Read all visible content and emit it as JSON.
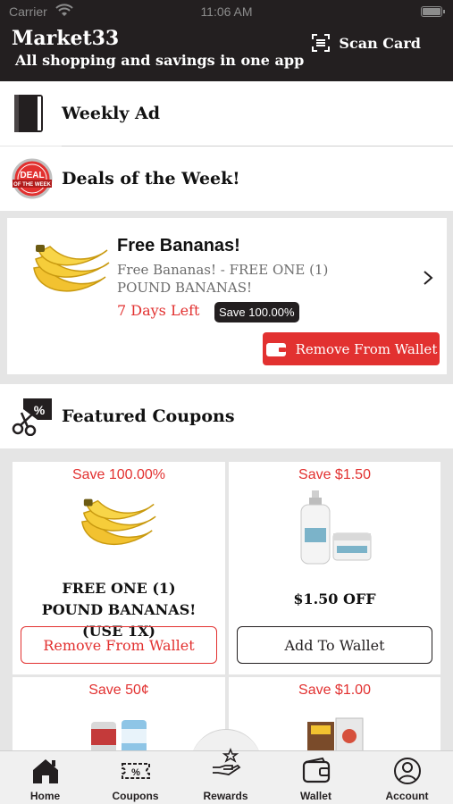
{
  "status_bar": {
    "carrier": "Carrier",
    "time": "11:06 AM"
  },
  "header": {
    "title": "Market33",
    "subtitle": "All shopping and savings in one app",
    "scan_label": "Scan Card"
  },
  "sections": {
    "weekly_ad": "Weekly Ad",
    "deals": "Deals of the Week!",
    "deal_badge_text": [
      "DEAL",
      "OF THE WEEK"
    ],
    "featured": "Featured Coupons"
  },
  "deal": {
    "title": "Free Bananas!",
    "description": "Free Bananas! - FREE ONE (1) POUND BANANAS!",
    "days_left": "7 Days Left",
    "badge": "Save 100.00%",
    "button": "Remove From Wallet"
  },
  "coupons": [
    {
      "save": "Save 100.00%",
      "name": "FREE ONE (1) POUND BANANAS! (USE 1X)",
      "button": "Remove From Wallet"
    },
    {
      "save": "Save $1.50",
      "name": "$1.50 OFF",
      "button": "Add To Wallet"
    },
    {
      "save": "Save 50¢"
    },
    {
      "save": "Save $1.00"
    }
  ],
  "tabs": [
    {
      "label": "Home",
      "icon": "home-icon"
    },
    {
      "label": "Coupons",
      "icon": "coupon-icon"
    },
    {
      "label": "Rewards",
      "icon": "rewards-icon"
    },
    {
      "label": "Wallet",
      "icon": "wallet-icon"
    },
    {
      "label": "Account",
      "icon": "account-icon"
    }
  ],
  "colors": {
    "header_bg": "#231f20",
    "accent_red": "#e23130",
    "background": "#e5e5e5"
  }
}
